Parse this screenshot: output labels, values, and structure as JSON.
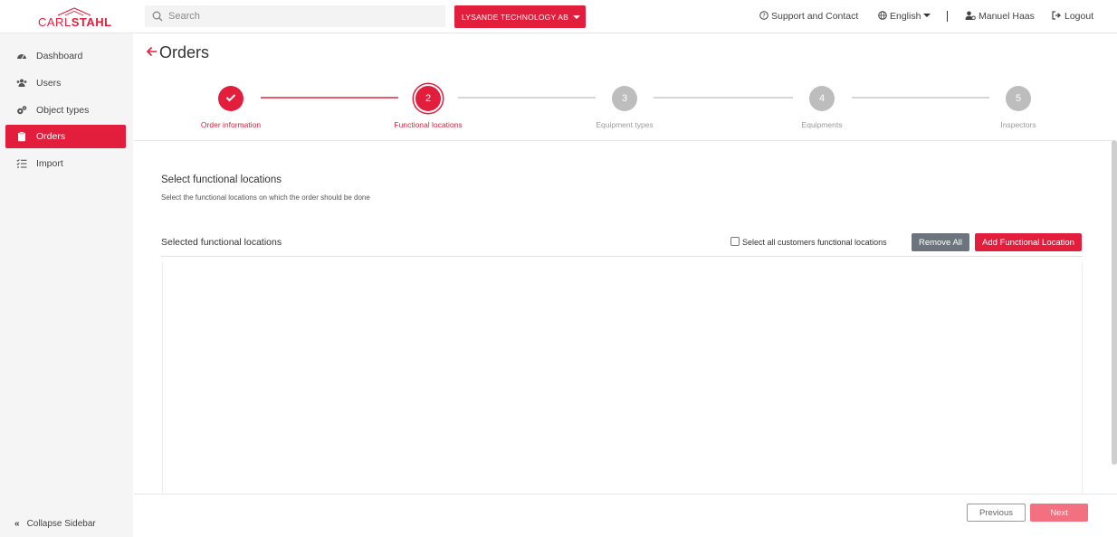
{
  "brand": {
    "logo_light": "CARL",
    "logo_bold": "STAHL",
    "accent_color": "#e31e3c"
  },
  "header": {
    "search_placeholder": "Search",
    "company": "LYSANDE TECHNOLOGY AB",
    "support": "Support and Contact",
    "language": "English",
    "user": "Manuel Haas",
    "logout": "Logout"
  },
  "sidebar": {
    "items": [
      {
        "label": "Dashboard",
        "icon": "dashboard-icon"
      },
      {
        "label": "Users",
        "icon": "users-icon"
      },
      {
        "label": "Object types",
        "icon": "gears-icon"
      },
      {
        "label": "Orders",
        "icon": "clipboard-icon",
        "active": true
      },
      {
        "label": "Import",
        "icon": "list-icon"
      }
    ],
    "collapse": "Collapse Sidebar"
  },
  "page": {
    "title": "Orders"
  },
  "stepper": {
    "current_step": 2,
    "steps": [
      {
        "number": "",
        "label": "Order information",
        "state": "done"
      },
      {
        "number": "2",
        "label": "Functional locations",
        "state": "current"
      },
      {
        "number": "3",
        "label": "Equipment types",
        "state": "pending"
      },
      {
        "number": "4",
        "label": "Equipments",
        "state": "pending"
      },
      {
        "number": "5",
        "label": "Inspectors",
        "state": "pending"
      }
    ]
  },
  "section": {
    "title": "Select functional locations",
    "description": "Select the functional locations on which the order should be done",
    "selected_title": "Selected functional locations",
    "select_all_label": "Select all customers functional locations",
    "select_all_checked": false,
    "remove_all": "Remove All",
    "add_location": "Add Functional Location"
  },
  "footer": {
    "previous": "Previous",
    "next": "Next"
  }
}
